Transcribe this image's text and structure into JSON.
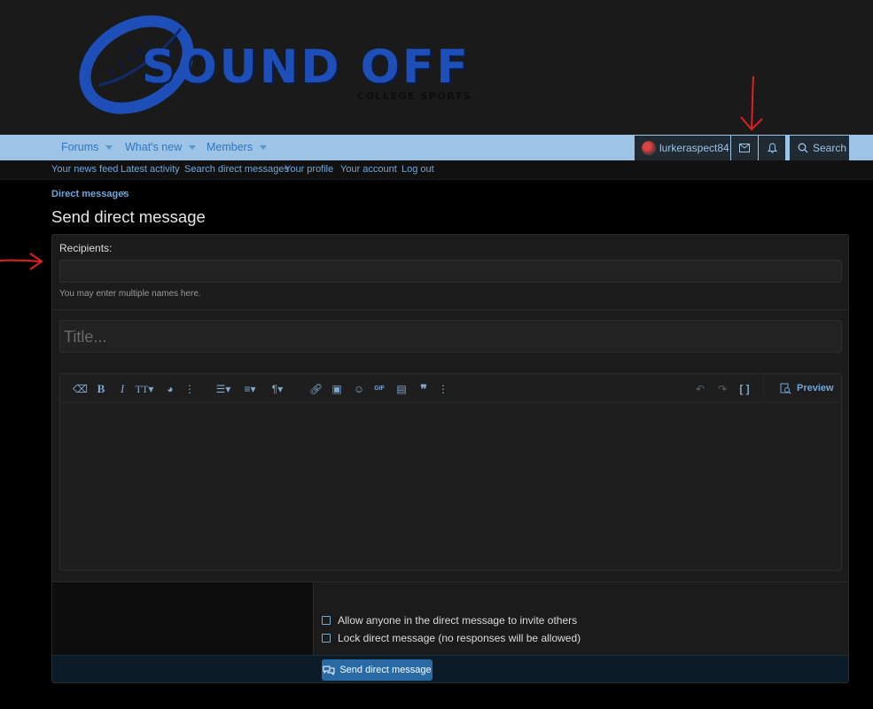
{
  "site": {
    "logo_text": "SOUND OFF",
    "logo_sub": "COLLEGE SPORTS",
    "brand_color": "#1e4fb8"
  },
  "nav": {
    "tabs": [
      {
        "label": "Forums"
      },
      {
        "label": "What's new"
      },
      {
        "label": "Members"
      }
    ],
    "username": "lurkeraspect84",
    "search_label": "Search",
    "bar_color": "#9dc4e6"
  },
  "subnav": {
    "items": [
      {
        "label": "Your news feed"
      },
      {
        "label": "Latest activity"
      },
      {
        "label": "Search direct messages"
      },
      {
        "label": "Your profile"
      },
      {
        "label": "Your account"
      },
      {
        "label": "Log out"
      }
    ]
  },
  "breadcrumb": {
    "label": "Direct messages"
  },
  "page_title": "Send direct message",
  "form": {
    "recipients_label": "Recipients:",
    "recipients_value": "",
    "recipients_hint": "You may enter multiple names here.",
    "title_placeholder": "Title...",
    "preview_label": "Preview",
    "options": [
      {
        "label": "Allow anyone in the direct message to invite others",
        "checked": false
      },
      {
        "label": "Lock direct message (no responses will be allowed)",
        "checked": false
      }
    ],
    "submit_label": "Send direct message"
  },
  "toolbar": {
    "icons": [
      "eraser-icon",
      "bold-icon",
      "italic-icon",
      "text-size-icon",
      "palette-icon",
      "more-vertical-icon",
      "list-icon",
      "align-icon",
      "paragraph-icon",
      "link-icon",
      "image-icon",
      "smiley-icon",
      "gif-icon",
      "media-icon",
      "quote-icon",
      "more-vertical-icon",
      "undo-icon",
      "redo-icon",
      "bbcode-icon"
    ],
    "gif_text": "GIF"
  },
  "annotation_color": "#e0201e"
}
